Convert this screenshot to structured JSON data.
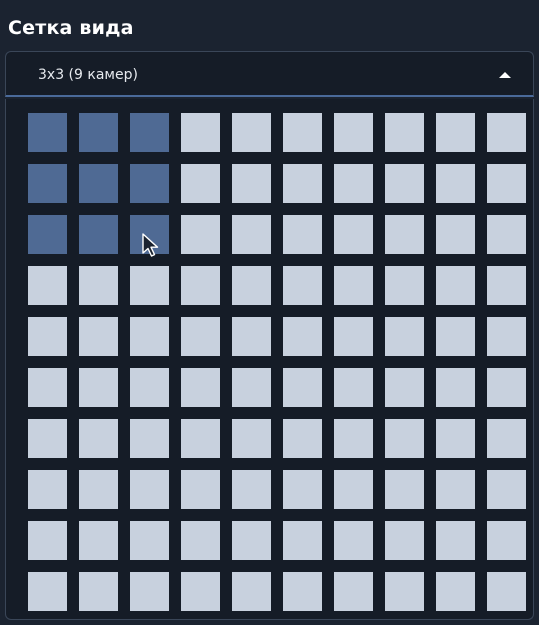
{
  "panel": {
    "title": "Сетка вида"
  },
  "dropdown": {
    "selected_label": "3x3 (9 камер)",
    "caret_icon": "caret-up-icon"
  },
  "grid": {
    "rows": 10,
    "cols": 10,
    "selected_rows": 3,
    "selected_cols": 3
  },
  "colors": {
    "background": "#1b2330",
    "cell": "#c8d1de",
    "cell_selected": "#4f6a94"
  }
}
